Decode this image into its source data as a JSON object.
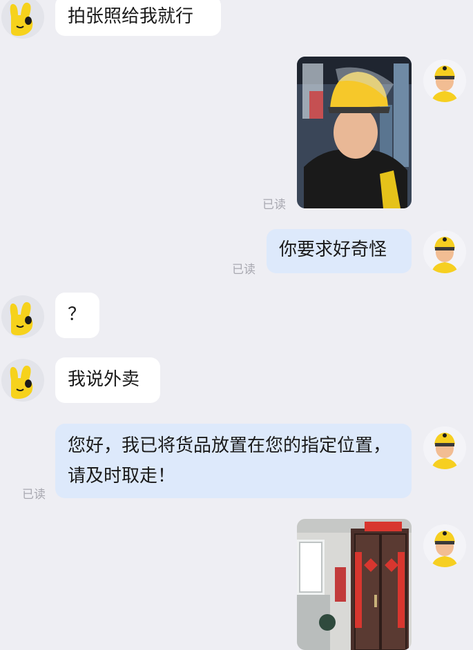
{
  "conversation": {
    "messages": [
      {
        "side": "in",
        "text": "拍张照给我就行"
      },
      {
        "side": "out",
        "kind": "photo",
        "subject": "selfie-courier-yellow-helmet",
        "read_label": "已读"
      },
      {
        "side": "out",
        "text": "你要求好奇怪",
        "read_label": "已读"
      },
      {
        "side": "in",
        "text": "？"
      },
      {
        "side": "in",
        "text": "我说外卖"
      },
      {
        "side": "out",
        "text": "您好，我已将货品放置在您的指定位置，请及时取走！",
        "read_label": "已读"
      },
      {
        "side": "out",
        "kind": "photo",
        "subject": "apartment-door-delivery"
      }
    ]
  },
  "colors": {
    "background": "#eeeef3",
    "incoming_bubble": "#ffffff",
    "outgoing_bubble": "#dde9fb",
    "read_label": "#a8a8b0",
    "helmet_yellow": "#f6cf21"
  }
}
